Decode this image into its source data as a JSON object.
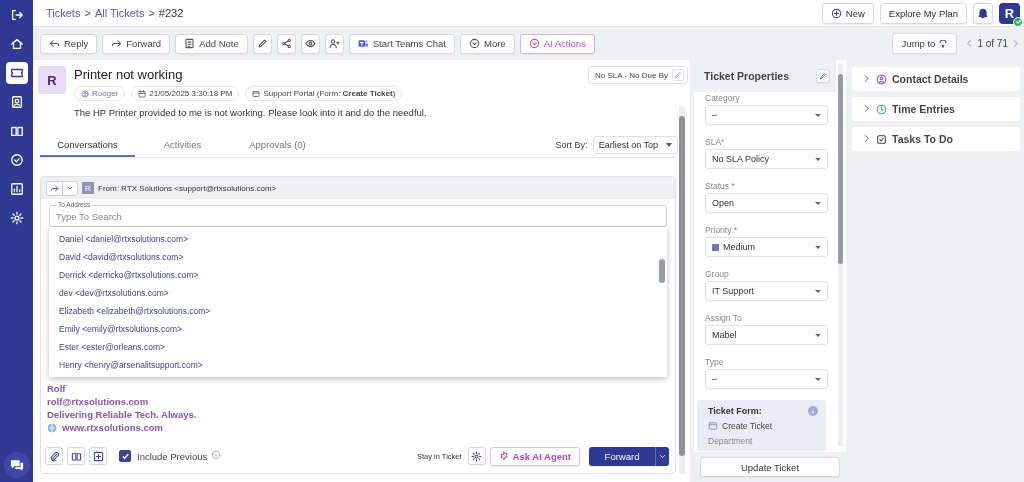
{
  "sidebar": {
    "items": [
      {
        "selected": false
      },
      {
        "selected": false
      },
      {
        "selected": true
      },
      {
        "selected": false
      },
      {
        "selected": false
      },
      {
        "selected": false
      },
      {
        "selected": false
      },
      {
        "selected": false
      }
    ]
  },
  "topbar": {
    "breadcrumb": {
      "separator": ">",
      "items": [
        {
          "label": "Tickets",
          "kind": "link"
        },
        {
          "label": "All Tickets",
          "kind": "link"
        },
        {
          "label": "#232",
          "kind": "current"
        }
      ]
    },
    "buttons": [
      "New",
      "Explore My Plan"
    ],
    "avatar": {
      "initial": "R",
      "online": true
    }
  },
  "toolbar": {
    "actions": [
      {
        "kind": "button",
        "label": "Reply"
      },
      {
        "kind": "button",
        "label": "Forward"
      },
      {
        "kind": "button",
        "label": "Add Note"
      },
      {
        "kind": "icon"
      },
      {
        "kind": "icon"
      },
      {
        "kind": "icon"
      },
      {
        "kind": "icon"
      },
      {
        "kind": "button",
        "label": "Start Teams Chat"
      },
      {
        "kind": "button",
        "label": "More"
      },
      {
        "kind": "ai",
        "label": "AI Actions"
      }
    ],
    "jump_to": "Jump to",
    "pager": "1 of 71"
  },
  "ticket": {
    "avatar": "R",
    "title": "Printer not working",
    "requester": "Rodger",
    "created": "21/05/2025 3:30:18 PM",
    "source": "Support Portal (Form: **Create Ticket**)",
    "sla": "No SLA - No Due By",
    "description": "The HP Printer provided to me is not working. Please look into it and do the needful.",
    "tabs": [
      {
        "label": "Conversations",
        "selected": true
      },
      {
        "label": "Activities",
        "selected": false
      },
      {
        "label": "Approvals (0)",
        "selected": false
      }
    ],
    "sort_by": {
      "label": "Sort By:",
      "value": "Earliest on Top"
    }
  },
  "composer": {
    "sender_initial": "R",
    "from_label": "From:",
    "from": "RTX Solutions <support@rtxsolutions.com>",
    "to_address": {
      "label": "To Address",
      "placeholder": "Type To Search"
    },
    "suggestions": [
      "Daniel <daniel@rtxsolutions.com>",
      "David <david@rtxsolutions.com>",
      "Derrick <derricko@rtxsolutions.com>",
      "dev <dev@rtxsolutions.com>",
      "Elizabeth <elizabeth@rtxsolutions.com>",
      "Emily <emily@rtxsolutions.com>",
      "Ester <ester@orleans.com>",
      "Henry <henry@arsenalitsupport.com>"
    ],
    "signature": {
      "name": "Rolf",
      "email": "rolf@rtxsolutions.com",
      "tagline": "Delivering Reliable Tech. Always.",
      "website": "www.rtxsolutions.com"
    },
    "include_previous": {
      "label": "Include Previous",
      "checked": true
    },
    "stay_in_ticket": "Stay in Ticket",
    "ask_ai": "Ask AI Agent",
    "send": "Forward"
  },
  "properties": {
    "title": "Ticket Properties",
    "fields": [
      {
        "label": "Category",
        "value": "–"
      },
      {
        "label": "SLA*",
        "value": "No SLA Policy"
      },
      {
        "label": "Status *",
        "value": "Open"
      },
      {
        "label": "Priority *",
        "value": "Medium",
        "color": "#7476b4"
      },
      {
        "label": "Group",
        "value": "IT Support"
      },
      {
        "label": "Assign To",
        "value": "Mabel"
      },
      {
        "label": "Type",
        "value": "–"
      }
    ],
    "ticket_form": {
      "label": "Ticket Form:",
      "value": "Create Ticket",
      "next_label": "Department"
    },
    "update_button": "Update Ticket"
  },
  "side_cards": [
    {
      "title": "Contact Details",
      "expanded": false
    },
    {
      "title": "Time Entries",
      "expanded": false
    },
    {
      "title": "Tasks To Do",
      "expanded": false
    }
  ]
}
